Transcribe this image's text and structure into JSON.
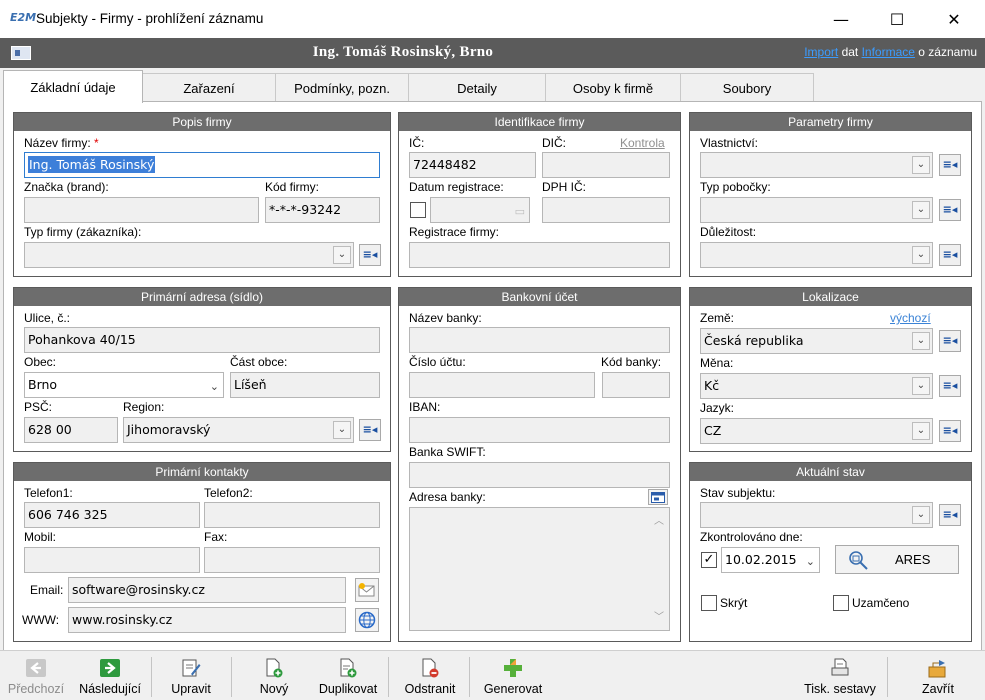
{
  "window": {
    "title": "Subjekty - Firmy - prohlížení záznamu",
    "logo": "E2M",
    "minimize": "—",
    "maximize": "☐",
    "close": "✕"
  },
  "record": {
    "name": "Ing. Tomáš Rosinský, Brno",
    "import_link": "Import",
    "import_text": " dat  ",
    "info_link": "Informace",
    "info_text": " o záznamu"
  },
  "tabs": [
    "Základní údaje",
    "Zařazení",
    "Podmínky, pozn.",
    "Detaily",
    "Osoby k firmě",
    "Soubory"
  ],
  "popis": {
    "header": "Popis firmy",
    "nazev_label": "Název firmy:",
    "nazev_req": "*",
    "nazev_value": "Ing. Tomáš Rosinský",
    "znacka_label": "Značka (brand):",
    "znacka_value": "",
    "kod_label": "Kód firmy:",
    "kod_value": "*-*-*-93242",
    "typ_label": "Typ firmy (zákazníka):",
    "typ_value": ""
  },
  "identifikace": {
    "header": "Identifikace firmy",
    "ic_label": "IČ:",
    "ic_value": "72448482",
    "dic_label": "DIČ:",
    "kontrola_link": "Kontrola",
    "dic_value": "",
    "datum_label": "Datum registrace:",
    "dph_label": "DPH IČ:",
    "reg_label": "Registrace firmy:"
  },
  "parametry": {
    "header": "Parametry firmy",
    "vlastnictvi_label": "Vlastnictví:",
    "pobocka_label": "Typ pobočky:",
    "dulezitost_label": "Důležitost:"
  },
  "adresa": {
    "header": "Primární adresa (sídlo)",
    "ulice_label": "Ulice, č.:",
    "ulice_value": "Pohankova 40/15",
    "obec_label": "Obec:",
    "obec_value": "Brno",
    "cast_label": "Část obce:",
    "cast_value": "Líšeň",
    "psc_label": "PSČ:",
    "psc_value": "628 00",
    "region_label": "Region:",
    "region_value": "Jihomoravský"
  },
  "banka": {
    "header": "Bankovní účet",
    "nazev_label": "Název banky:",
    "cislo_label": "Číslo účtu:",
    "kod_label": "Kód banky:",
    "iban_label": "IBAN:",
    "swift_label": "Banka SWIFT:",
    "adresa_label": "Adresa banky:"
  },
  "lokalizace": {
    "header": "Lokalizace",
    "zeme_label": "Země:",
    "vychozi_link": "výchozí",
    "zeme_value": "Česká republika",
    "mena_label": "Měna:",
    "mena_value": "Kč",
    "jazyk_label": "Jazyk:",
    "jazyk_value": "CZ"
  },
  "kontakty": {
    "header": "Primární kontakty",
    "tel1_label": "Telefon1:",
    "tel1_value": "606 746 325",
    "tel2_label": "Telefon2:",
    "tel2_value": "",
    "mobil_label": "Mobil:",
    "fax_label": "Fax:",
    "email_label": "Email:",
    "email_value": "software@rosinsky.cz",
    "www_label": "WWW:",
    "www_value": "www.rosinsky.cz"
  },
  "stav": {
    "header": "Aktuální stav",
    "stav_label": "Stav subjektu:",
    "zkontrolovano_label": "Zkontrolováno dne:",
    "zkontrolovano_checked": "✓",
    "datum_value": "10.02.2015",
    "ares_label": "ARES",
    "skryt_label": "Skrýt",
    "uzamceno_label": "Uzamčeno"
  },
  "toolbar": {
    "predchozi": "Předchozí",
    "nasledujici": "Následující",
    "upravit": "Upravit",
    "novy": "Nový",
    "duplikovat": "Duplikovat",
    "odstranit": "Odstranit",
    "generovat": "Generovat",
    "tisk": "Tisk. sestavy",
    "zavrit": "Zavřít"
  },
  "colors": {
    "group_header": "#6d6d6d",
    "record_bar": "#5b5b5b",
    "link": "#3b9cff",
    "selection": "#3d7fd9",
    "required": "#e00000"
  }
}
